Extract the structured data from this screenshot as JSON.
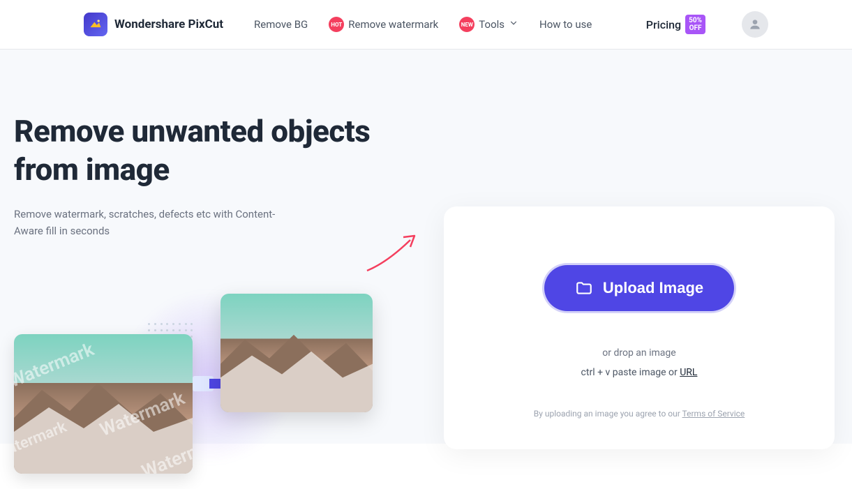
{
  "brand": "Wondershare PixCut",
  "nav": {
    "remove_bg": "Remove BG",
    "remove_watermark": "Remove watermark",
    "tools": "Tools",
    "how_to_use": "How to use",
    "hot_badge": "HOT",
    "new_badge": "NEW"
  },
  "pricing": {
    "label": "Pricing",
    "off": "50%\nOFF"
  },
  "hero": {
    "title": "Remove unwanted objects from image",
    "subtitle": "Remove watermark, scratches, defects etc with Content-Aware fill in seconds",
    "watermark_text": "Watermark"
  },
  "upload": {
    "button": "Upload Image",
    "drop": "or drop an image",
    "paste_prefix": "ctrl + v paste image or ",
    "url": "URL",
    "tos_prefix": "By uploading an image you agree to our ",
    "tos": "Terms of Service"
  }
}
